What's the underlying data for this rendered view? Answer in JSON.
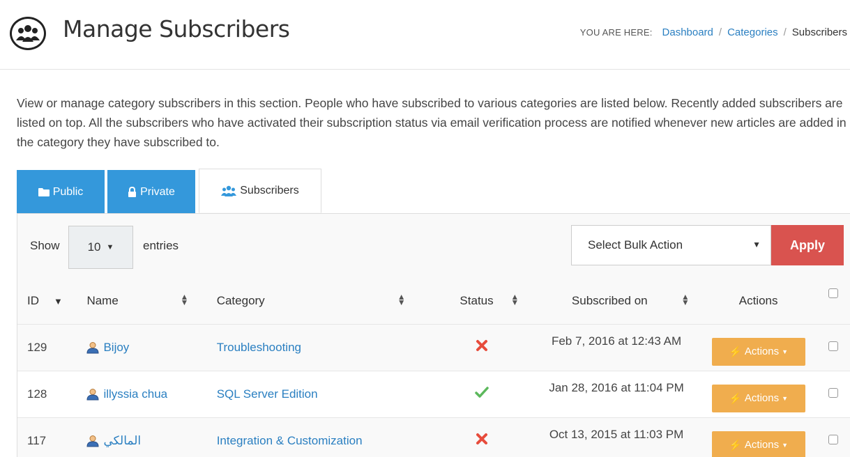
{
  "header": {
    "title": "Manage Subscribers",
    "breadcrumb_prefix": "YOU ARE HERE:",
    "breadcrumb": [
      {
        "label": "Dashboard",
        "link": true
      },
      {
        "label": "Categories",
        "link": true
      },
      {
        "label": "Subscribers",
        "link": false
      }
    ]
  },
  "description": "View or manage category subscribers in this section. People who have subscribed to various categories are listed below. Recently added subscribers are listed on top. All the subscribers who have activated their subscription status via email verification process are notified whenever new articles are added in the category they have subscribed to.",
  "tabs": [
    {
      "label": "Public",
      "icon": "folder-icon"
    },
    {
      "label": "Private",
      "icon": "lock-icon"
    },
    {
      "label": "Subscribers",
      "icon": "users-icon",
      "active": true
    }
  ],
  "controls": {
    "show_label": "Show",
    "entries_value": "10",
    "entries_label": "entries",
    "bulk_action": "Select Bulk Action",
    "apply_label": "Apply"
  },
  "table": {
    "columns": [
      "ID",
      "Name",
      "Category",
      "Status",
      "Subscribed on",
      "Actions"
    ],
    "rows": [
      {
        "id": "129",
        "name": "Bijoy",
        "category": "Troubleshooting",
        "status": "inactive",
        "date": "Feb 7, 2016 at 12:43 AM",
        "action": "Actions"
      },
      {
        "id": "128",
        "name": "illyssia chua",
        "category": "SQL Server Edition",
        "status": "active",
        "date": "Jan 28, 2016 at 11:04 PM",
        "action": "Actions"
      },
      {
        "id": "117",
        "name": "المالكي",
        "category": "Integration & Customization",
        "status": "inactive",
        "date": "Oct 13, 2015 at 11:03 PM",
        "action": "Actions"
      }
    ]
  },
  "colors": {
    "tab_blue": "#3498db",
    "apply_red": "#d9534f",
    "actions_orange": "#f0ad4e",
    "link_blue": "#2a7fc1",
    "check_green": "#5cb85c",
    "cross_red": "#e74c3c"
  }
}
